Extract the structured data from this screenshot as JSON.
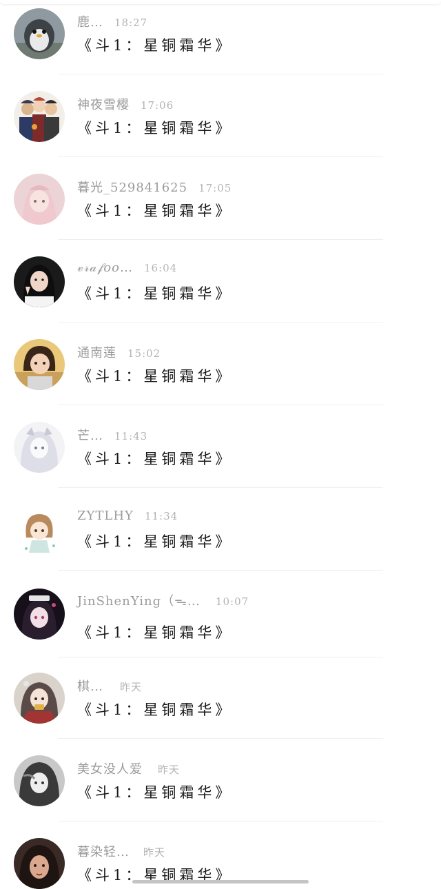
{
  "colors": {
    "background": "#ffffff",
    "name_text": "#9b9b9b",
    "time_text": "#b3b3b3",
    "message_text": "#1a1a1a",
    "divider": "#efefef"
  },
  "comments": [
    {
      "name": "鹿…",
      "time": "18:27",
      "message": "《斗1：星铜霜华》",
      "avatar": "penguin-plush-avatar"
    },
    {
      "name": "神夜雪樱",
      "time": "17:06",
      "message": "《斗1：星铜霜华》",
      "avatar": "anime-group-avatar"
    },
    {
      "name": "暮光_529841625",
      "time": "17:05",
      "message": "《斗1：星铜霜华》",
      "avatar": "pink-anime-girl-avatar"
    },
    {
      "name": "𝓋𝓇𝒶𝒻𝑜𝑜…",
      "time": "16:04",
      "message": "《斗1：星铜霜华》",
      "avatar": "girl-photo-avatar"
    },
    {
      "name": "通南莲",
      "time": "15:02",
      "message": "《斗1：星铜霜华》",
      "avatar": "child-photo-avatar"
    },
    {
      "name": "芒…",
      "time": "11:43",
      "message": "《斗1：星铜霜华》",
      "avatar": "sketch-girl-avatar"
    },
    {
      "name": "ZYTLHY",
      "time": "11:34",
      "message": "《斗1：星铜霜华》",
      "avatar": "chibi-girl-avatar"
    },
    {
      "name": "JinShenYing（ᯓ…",
      "time": "10:07",
      "message": "《斗1：星铜霜华》",
      "avatar": "dark-anime-girl-avatar"
    },
    {
      "name": "棋…",
      "time": "昨天",
      "message": "《斗1：星铜霜华》",
      "avatar": "hanfu-girl-avatar"
    },
    {
      "name": "美女没人爱",
      "time": "昨天",
      "message": "《斗1：星铜霜华》",
      "avatar": "monochrome-girl-avatar"
    },
    {
      "name": "暮染轻…",
      "time": "昨天",
      "message": "《斗1：星铜霜华》",
      "avatar": "dark-portrait-avatar"
    }
  ]
}
